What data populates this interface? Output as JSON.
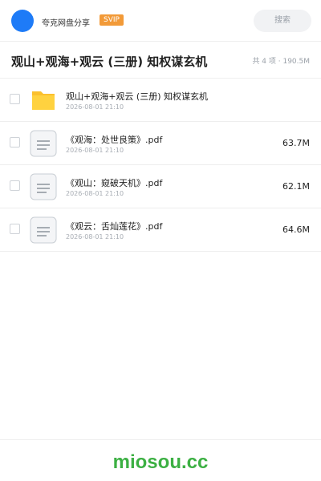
{
  "app": {
    "name": "夸克网盘分享",
    "badge": "SVIP",
    "search_placeholder": "搜索",
    "brand_color": "#1e7bf7",
    "badge_color": "#f29a38"
  },
  "folder": {
    "title": "观山+观海+观云 (三册) 知权谋玄机",
    "summary": "共 4 项 · 190.5M"
  },
  "items": [
    {
      "name": "观山+观海+观云 (三册) 知权谋玄机",
      "date": "2026-08-01 21:10",
      "size": "",
      "type": "folder-icon"
    },
    {
      "name": "《观海：处世良策》.pdf",
      "date": "2026-08-01 21:10",
      "size": "63.7M",
      "type": "pdf-file-icon"
    },
    {
      "name": "《观山：窥破天机》.pdf",
      "date": "2026-08-01 21:10",
      "size": "62.1M",
      "type": "pdf-file-icon"
    },
    {
      "name": "《观云：舌灿莲花》.pdf",
      "date": "2026-08-01 21:10",
      "size": "64.6M",
      "type": "pdf-file-icon"
    }
  ],
  "watermark": "miosou.cc"
}
